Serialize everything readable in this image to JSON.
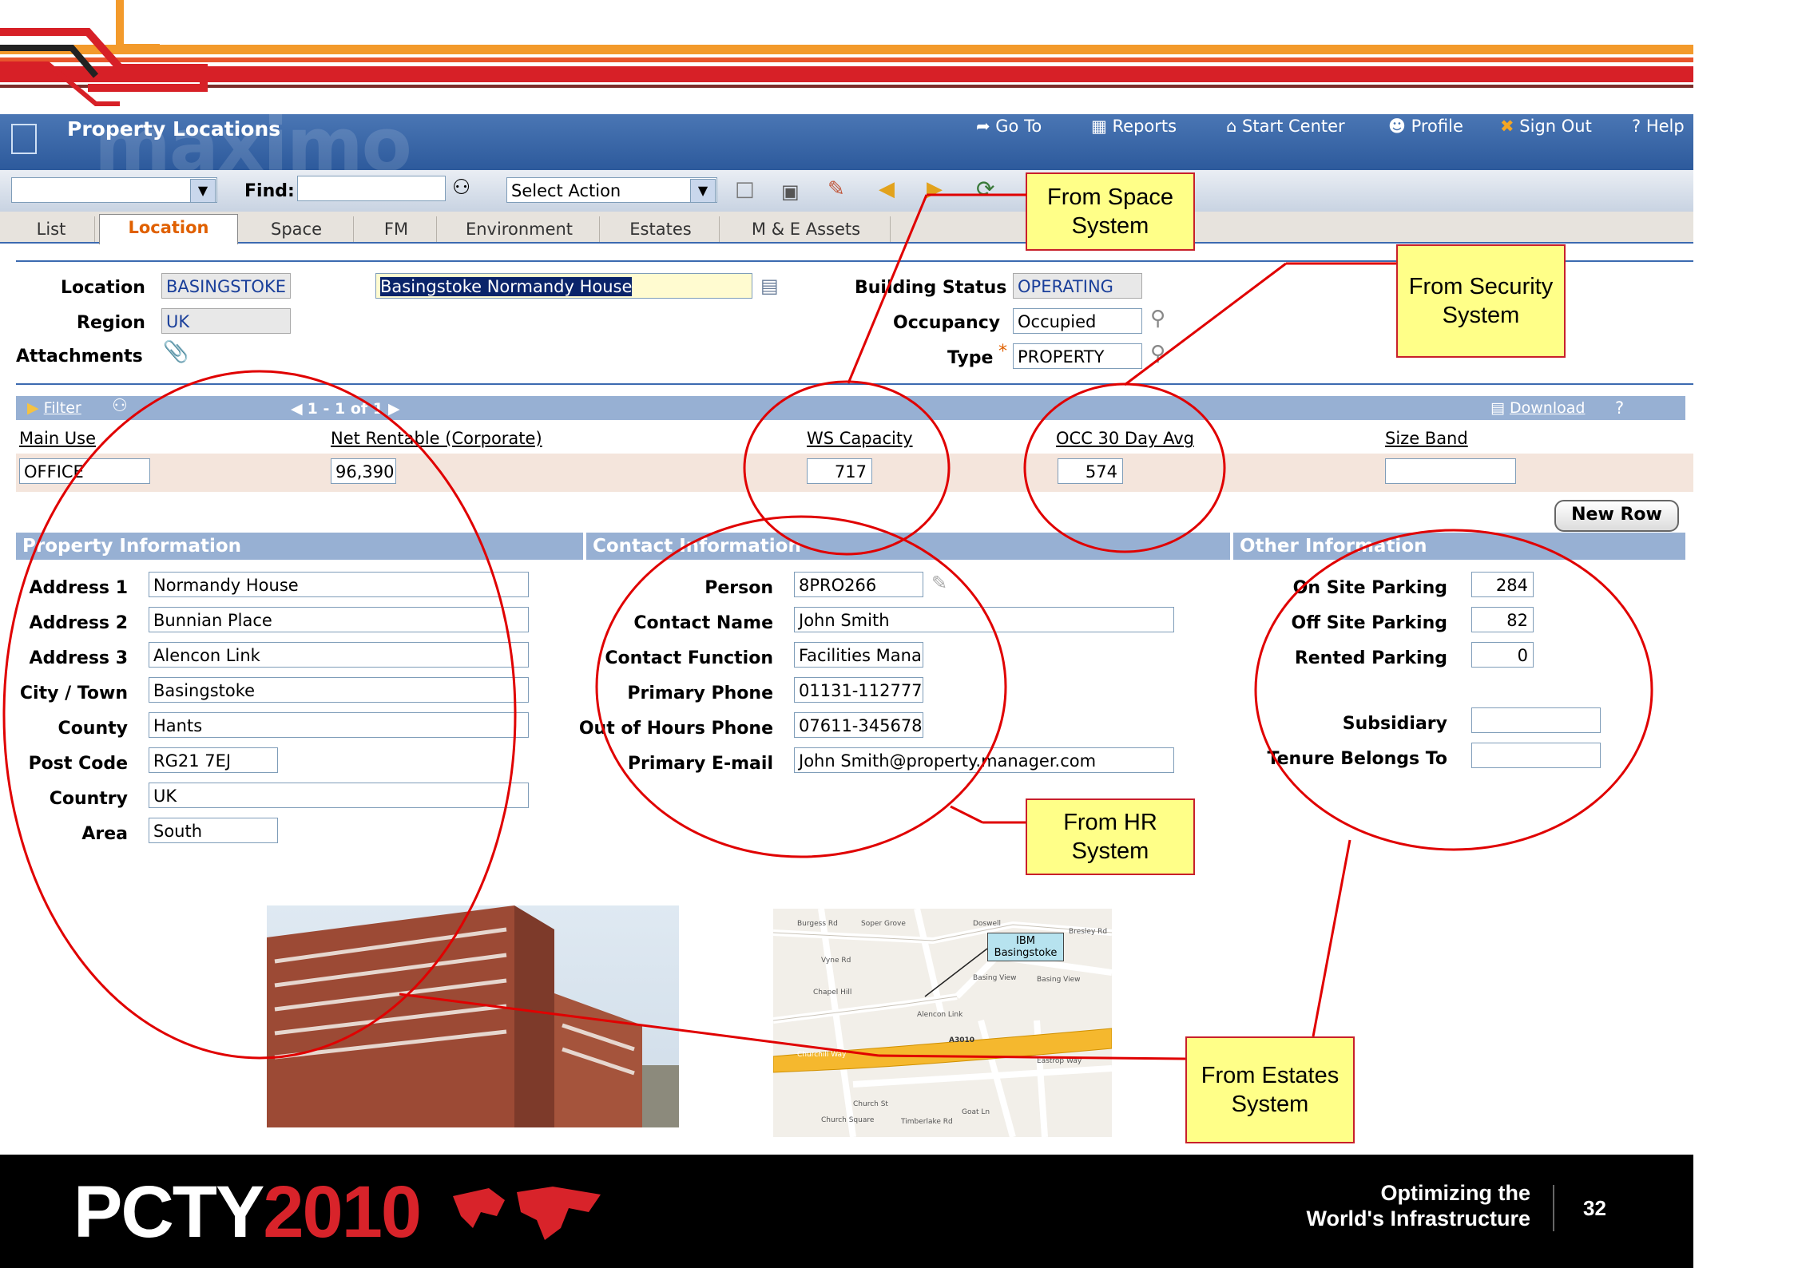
{
  "app": {
    "title": "Property Locations",
    "watermark": "maximo",
    "nav": {
      "goto": "Go To",
      "reports": "Reports",
      "start_center": "Start Center",
      "profile": "Profile",
      "sign_out": "Sign Out",
      "help": "Help"
    }
  },
  "toolbar": {
    "find_label": "Find:",
    "find_value": "",
    "select_action": "Select Action"
  },
  "tabs": [
    "List",
    "Location",
    "Space",
    "FM",
    "Environment",
    "Estates",
    "M & E Assets"
  ],
  "active_tab": "Location",
  "header_fields": {
    "location_label": "Location",
    "location": "BASINGSTOKE",
    "location_desc": "Basingstoke Normandy House",
    "region_label": "Region",
    "region": "UK",
    "attachments_label": "Attachments",
    "building_status_label": "Building Status",
    "building_status": "OPERATING",
    "occupancy_label": "Occupancy",
    "occupancy": "Occupied",
    "type_label": "Type",
    "type_required": "*",
    "type": "PROPERTY"
  },
  "table": {
    "filter": "Filter",
    "pager": "1 - 1 of 1",
    "download": "Download",
    "help": "?",
    "columns": [
      "Main Use",
      "Net Rentable (Corporate)",
      "WS Capacity",
      "OCC 30 Day Avg",
      "Size Band"
    ],
    "row": [
      "OFFICE",
      "96,390",
      "717",
      "574",
      ""
    ],
    "new_row": "New Row"
  },
  "property_info": {
    "title": "Property Information",
    "fields": [
      {
        "label": "Address 1",
        "value": "Normandy House"
      },
      {
        "label": "Address 2",
        "value": "Bunnian Place"
      },
      {
        "label": "Address 3",
        "value": "Alencon Link"
      },
      {
        "label": "City / Town",
        "value": "Basingstoke"
      },
      {
        "label": "County",
        "value": "Hants"
      },
      {
        "label": "Post Code",
        "value": "RG21 7EJ"
      },
      {
        "label": "Country",
        "value": "UK"
      },
      {
        "label": "Area",
        "value": "South"
      }
    ]
  },
  "contact_info": {
    "title": "Contact Information",
    "fields": [
      {
        "label": "Person",
        "value": "8PRO266"
      },
      {
        "label": "Contact Name",
        "value": "John Smith"
      },
      {
        "label": "Contact Function",
        "value": "Facilities Manag"
      },
      {
        "label": "Primary Phone",
        "value": "01131-112777"
      },
      {
        "label": "Out of Hours Phone",
        "value": "07611-345678"
      },
      {
        "label": "Primary E-mail",
        "value": "John Smith@property.manager.com"
      }
    ]
  },
  "other_info": {
    "title": "Other Information",
    "fields": [
      {
        "label": "On Site Parking",
        "value": "284"
      },
      {
        "label": "Off Site Parking",
        "value": "82"
      },
      {
        "label": "Rented Parking",
        "value": "0"
      },
      {
        "label": "Subsidiary",
        "value": ""
      },
      {
        "label": "Tenure Belongs To",
        "value": ""
      }
    ]
  },
  "callouts": {
    "space": "From Space System",
    "security": "From Security System",
    "hr": "From HR System",
    "estates": "From Estates System"
  },
  "map": {
    "label": "IBM Basingstoke",
    "roads": [
      "Burgess Rd",
      "Soper Grove",
      "Doswell",
      "Bresley Rd",
      "Vyne Rd",
      "Chapel Hill",
      "Basing View",
      "Alencon Link",
      "A3010",
      "Churchill Way",
      "Church St",
      "Eastrop Way",
      "Church Square",
      "Timberlake Rd",
      "Goat Ln",
      "Basing View"
    ]
  },
  "footer": {
    "brand": "PCTY",
    "year": "2010",
    "tagline_1": "Optimizing the",
    "tagline_2": "World's Infrastructure",
    "page": "32"
  },
  "colors": {
    "header_blue": "#2d5a9c",
    "section_blue": "#97b0d3",
    "callout_fill": "#ffff88",
    "annotation_red": "#e00000",
    "brand_red": "#d8232a"
  }
}
